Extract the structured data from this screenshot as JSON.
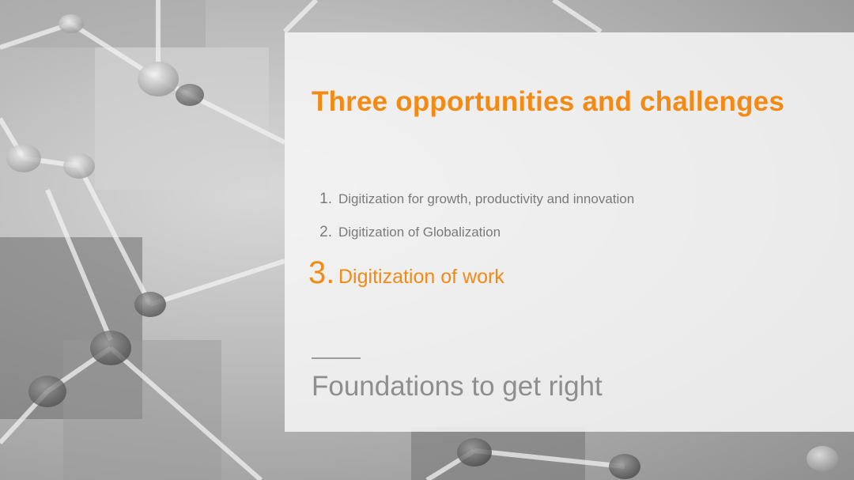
{
  "slide": {
    "title": "Three opportunities and challenges",
    "items": [
      {
        "number": "1.",
        "text": "Digitization for growth, productivity and innovation",
        "active": false
      },
      {
        "number": "2.",
        "text": "Digitization of Globalization",
        "active": false
      },
      {
        "number": "3.",
        "text": "Digitization of work",
        "active": true
      }
    ],
    "section_title": "Foundations to get right"
  },
  "colors": {
    "accent": "#f28a14",
    "muted_text": "#7a7a7a",
    "section_text": "#8e8e8e",
    "panel": "#f6f6f6"
  }
}
